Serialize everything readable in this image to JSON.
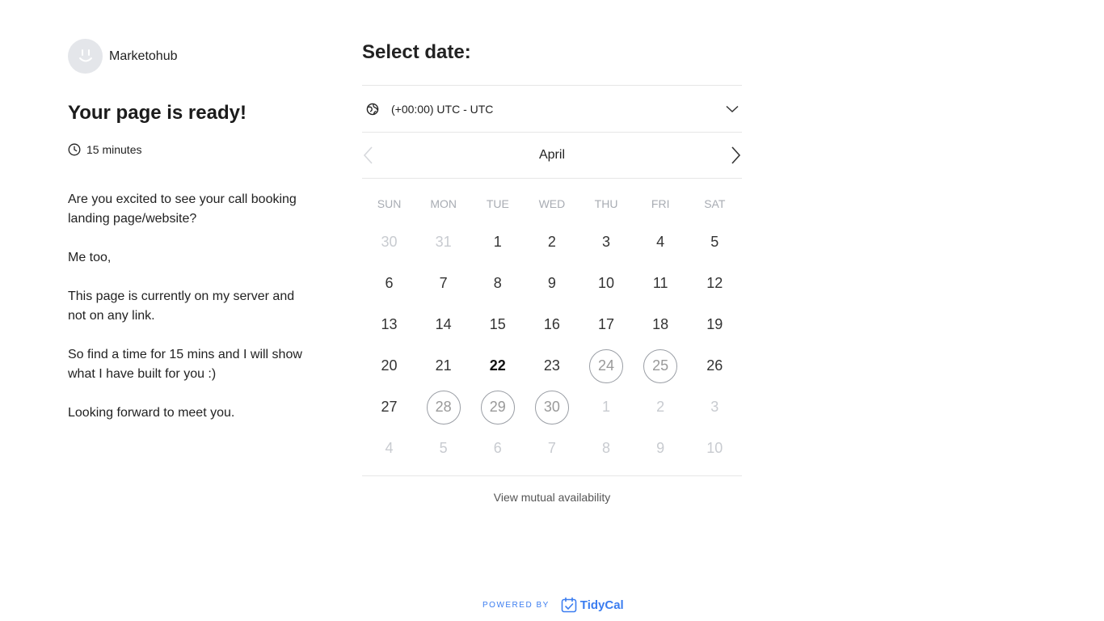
{
  "host": {
    "name": "Marketohub",
    "avatar_icon": "smiley-icon"
  },
  "event": {
    "title": "Your page is ready!",
    "duration": "15 minutes",
    "description": [
      "Are you excited to see your call booking landing page/website?",
      "Me too,",
      "This page is currently on my server and not on any link.",
      "So find a time for 15 mins and I will show what I have built for you :)",
      "Looking forward to meet you."
    ]
  },
  "booking": {
    "heading": "Select date:",
    "timezone": "(+00:00) UTC - UTC",
    "month": "April",
    "weekdays": [
      "SUN",
      "MON",
      "TUE",
      "WED",
      "THU",
      "FRI",
      "SAT"
    ],
    "days": [
      {
        "label": "30",
        "state": "muted"
      },
      {
        "label": "31",
        "state": "muted"
      },
      {
        "label": "1",
        "state": "normal"
      },
      {
        "label": "2",
        "state": "normal"
      },
      {
        "label": "3",
        "state": "normal"
      },
      {
        "label": "4",
        "state": "normal"
      },
      {
        "label": "5",
        "state": "normal"
      },
      {
        "label": "6",
        "state": "normal"
      },
      {
        "label": "7",
        "state": "normal"
      },
      {
        "label": "8",
        "state": "normal"
      },
      {
        "label": "9",
        "state": "normal"
      },
      {
        "label": "10",
        "state": "normal"
      },
      {
        "label": "11",
        "state": "normal"
      },
      {
        "label": "12",
        "state": "normal"
      },
      {
        "label": "13",
        "state": "normal"
      },
      {
        "label": "14",
        "state": "normal"
      },
      {
        "label": "15",
        "state": "normal"
      },
      {
        "label": "16",
        "state": "normal"
      },
      {
        "label": "17",
        "state": "normal"
      },
      {
        "label": "18",
        "state": "normal"
      },
      {
        "label": "19",
        "state": "normal"
      },
      {
        "label": "20",
        "state": "normal"
      },
      {
        "label": "21",
        "state": "normal"
      },
      {
        "label": "22",
        "state": "today"
      },
      {
        "label": "23",
        "state": "normal"
      },
      {
        "label": "24",
        "state": "available"
      },
      {
        "label": "25",
        "state": "available"
      },
      {
        "label": "26",
        "state": "normal"
      },
      {
        "label": "27",
        "state": "normal"
      },
      {
        "label": "28",
        "state": "available"
      },
      {
        "label": "29",
        "state": "available"
      },
      {
        "label": "30",
        "state": "available"
      },
      {
        "label": "1",
        "state": "muted"
      },
      {
        "label": "2",
        "state": "muted"
      },
      {
        "label": "3",
        "state": "muted"
      },
      {
        "label": "4",
        "state": "muted"
      },
      {
        "label": "5",
        "state": "muted"
      },
      {
        "label": "6",
        "state": "muted"
      },
      {
        "label": "7",
        "state": "muted"
      },
      {
        "label": "8",
        "state": "muted"
      },
      {
        "label": "9",
        "state": "muted"
      },
      {
        "label": "10",
        "state": "muted"
      }
    ],
    "mutual_link": "View mutual availability"
  },
  "footer": {
    "powered_by": "POWERED BY",
    "brand": "TidyCal",
    "brand_color": "#3b7df0"
  },
  "icons": {
    "duration": "clock-icon",
    "timezone": "globe-icon",
    "timezone_toggle": "chevron-down-icon",
    "prev_month": "chevron-left-icon",
    "next_month": "chevron-right-icon",
    "brand": "tidycal-logo-icon"
  }
}
